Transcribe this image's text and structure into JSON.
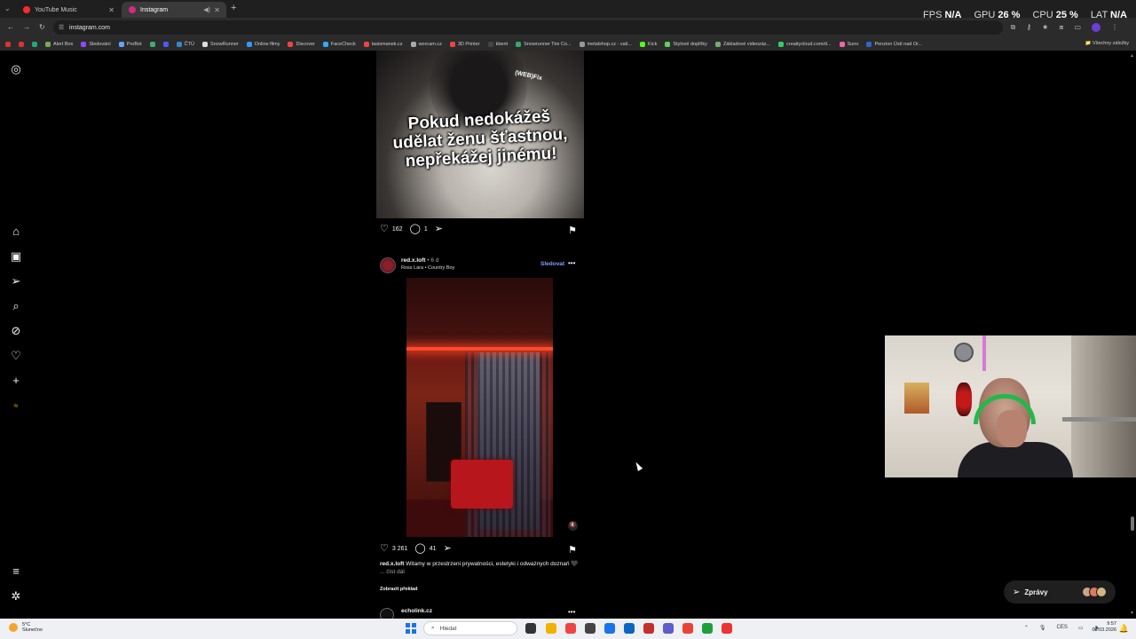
{
  "browser": {
    "tabs": [
      {
        "label": "YouTube Music",
        "color": "#ff2b2b"
      },
      {
        "label": "Instagram",
        "color": "#d6297e"
      }
    ],
    "url": "instagram.com",
    "bookmarks": [
      {
        "label": "",
        "color": "#d33"
      },
      {
        "label": "",
        "color": "#d33"
      },
      {
        "label": "",
        "color": "#2a7"
      },
      {
        "label": "Alert Box",
        "color": "#7a5"
      },
      {
        "label": "Sledování",
        "color": "#9146ff"
      },
      {
        "label": "ProBot",
        "color": "#6aa0ff"
      },
      {
        "label": "",
        "color": "#4a7"
      },
      {
        "label": "",
        "color": "#55f"
      },
      {
        "label": "ČTÚ",
        "color": "#38c"
      },
      {
        "label": "SnowRunner",
        "color": "#ddd"
      },
      {
        "label": "Online filmy",
        "color": "#39f"
      },
      {
        "label": "Discover",
        "color": "#e44"
      },
      {
        "label": "FaceCheck",
        "color": "#3af"
      },
      {
        "label": "tasismanek.cz",
        "color": "#e44"
      },
      {
        "label": "worcam.cz",
        "color": "#aaa"
      },
      {
        "label": "3D Printer",
        "color": "#e44"
      },
      {
        "label": "kbent",
        "color": "#444"
      },
      {
        "label": "Snowrunner Tire Co...",
        "color": "#3a6"
      },
      {
        "label": "metalshop.cz - vaš...",
        "color": "#999"
      },
      {
        "label": "Kick",
        "color": "#53fc18"
      },
      {
        "label": "Stylové doplňky",
        "color": "#6c6"
      },
      {
        "label": "Základové videozáz...",
        "color": "#7a7"
      },
      {
        "label": "creaitycloud.com/d...",
        "color": "#3c6"
      },
      {
        "label": "Suno",
        "color": "#e6a"
      },
      {
        "label": "Penzion Ústí nad Or...",
        "color": "#36c"
      }
    ],
    "all_bookmarks_label": "Všechny záložky"
  },
  "perf": {
    "fps_label": "FPS",
    "fps_value": "N/A",
    "gpu_label": "GPU",
    "gpu_value": "26 %",
    "cpu_label": "CPU",
    "cpu_value": "25 %",
    "lat_label": "LAT",
    "lat_value": "N/A"
  },
  "sidebar_icons": [
    "instagram-logo-icon",
    "home-icon",
    "reels-icon",
    "send-icon",
    "search-icon",
    "explore-icon",
    "heart-icon",
    "create-icon",
    "threads-icon",
    "menu-icon",
    "more-icon"
  ],
  "post1": {
    "overlay_text": "Pokud nedokážeš udělat ženu šťastnou, nepřekážej jinému!",
    "watermark": "(WEB)Fix",
    "likes": "162",
    "comments": "1"
  },
  "post2": {
    "username": "red.x.loft",
    "age": "• 6 d",
    "audio": "Ross Lara • Country Boy",
    "follow_label": "Sledovat",
    "likes": "3 261",
    "comments": "41",
    "caption_user": "red.x.loft",
    "caption_text": "Witamy w przestrzeni prywatności, estetyki i odważnych doznań 🖤",
    "more_label": "... číst dál",
    "translate_label": "Zobrazit překlad"
  },
  "post3": {
    "username": "echolink.cz"
  },
  "messages": {
    "label": "Zprávy",
    "avatar_colors": [
      "#c9a58c",
      "#e07a5f",
      "#d4b483"
    ]
  },
  "taskbar": {
    "weather_temp": "5°C",
    "weather_desc": "Slunečno",
    "search_placeholder": "Hledat",
    "lang": "CES",
    "time": "9:57",
    "date": "03.03.2026",
    "apps": [
      "#333",
      "#f2b200",
      "#e44",
      "#444",
      "#1a73e8",
      "#0a66c2",
      "#c4302b",
      "#5b5fc7",
      "#ea4335",
      "#1e9f3a",
      "#e33"
    ]
  }
}
